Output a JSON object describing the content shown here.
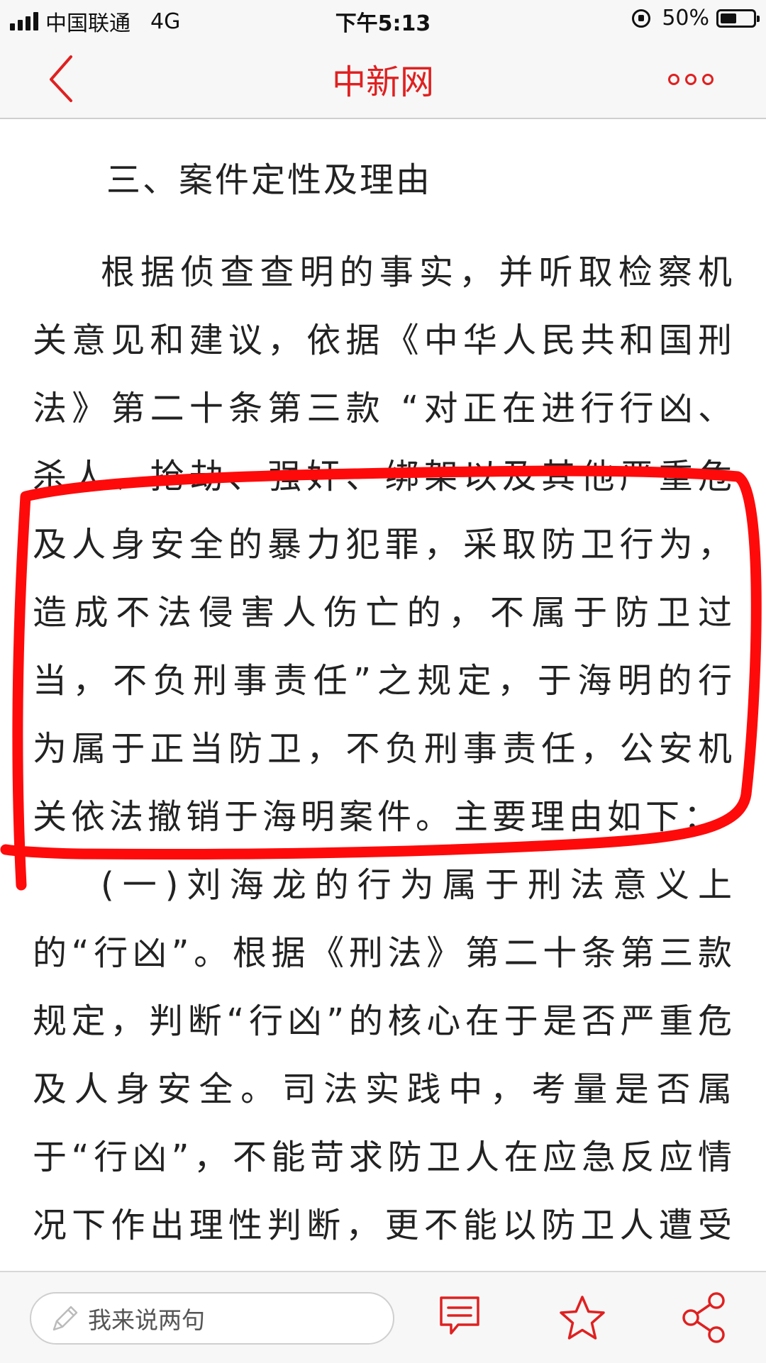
{
  "status_bar": {
    "carrier": "中国联通",
    "network": "4G",
    "time": "下午5:13",
    "battery": "50%",
    "battery_level": 0.5
  },
  "nav": {
    "title": "中新网",
    "back_icon": "chevron-left-icon",
    "more_icon": "more-dots-icon"
  },
  "article": {
    "heading": "三、案件定性及理由",
    "paragraphs": [
      "根据侦查查明的事实，并听取检察机关意见和建议，依据《中华人民共和国刑法》第二十条第三款 “对正在进行行凶、杀人、抢劫、强奸、绑架以及其他严重危及人身安全的暴力犯罪，采取防卫行为，造成不法侵害人伤亡的，不属于防卫过当，不负刑事责任”之规定，于海明的行为属于正当防卫，不负刑事责任，公安机关依法撤销于海明案件。主要理由如下：",
      "(一)刘海龙的行为属于刑法意义上的“行凶”。根据《刑法》第二十条第三款规定，判断“行凶”的核心在于是否严重危及人身安全。司法实践中，考量是否属于“行凶”，不能苛求防卫人在应急反应情况下作出理性判断，更不能以防卫人遭受实际伤"
    ]
  },
  "bottom_bar": {
    "comment_placeholder": "我来说两句",
    "comment_icon": "comment-icon",
    "favorite_icon": "star-icon",
    "share_icon": "share-icon"
  },
  "colors": {
    "brand": "#e02020",
    "annotation": "#ff0a0a"
  }
}
